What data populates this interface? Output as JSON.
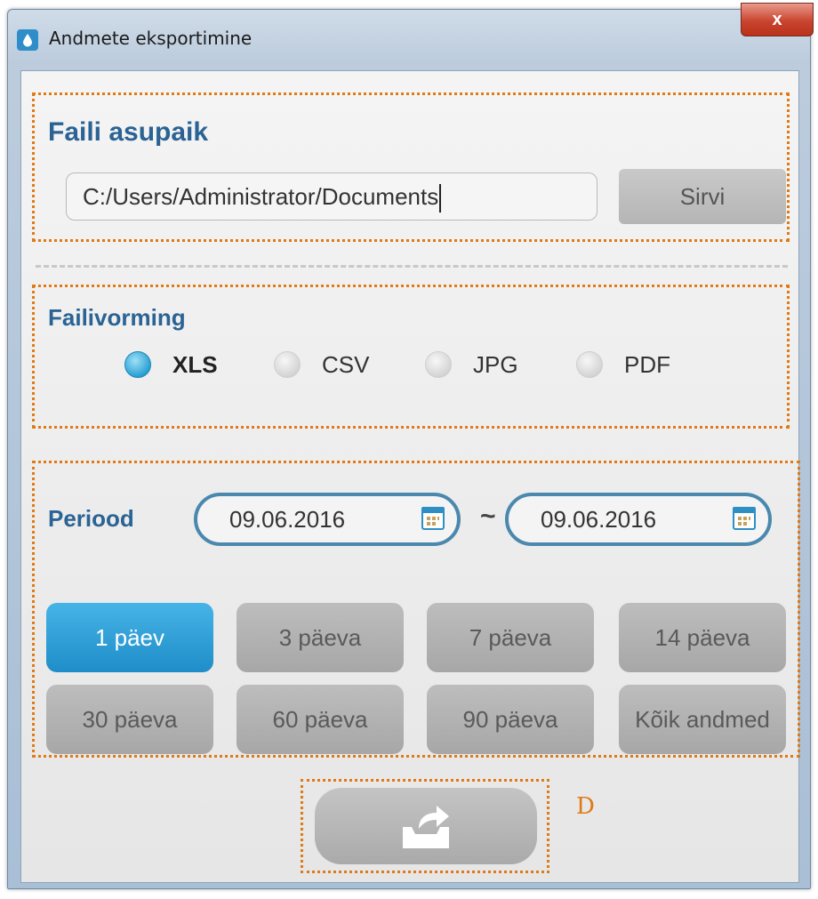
{
  "window": {
    "title": "Andmete eksportimine",
    "close_label": "x"
  },
  "location": {
    "heading": "Faili asupaik",
    "path_value": "C:/Users/Administrator/Documents",
    "browse_label": "Sirvi"
  },
  "format": {
    "heading": "Failivorming",
    "options": [
      "XLS",
      "CSV",
      "JPG",
      "PDF"
    ],
    "selected": "XLS"
  },
  "period": {
    "label": "Periood",
    "start_date": "09.06.2016",
    "separator": "~",
    "end_date": "09.06.2016",
    "ranges": [
      "1 päev",
      "3 päeva",
      "7 päeva",
      "14 päeva",
      "30 päeva",
      "60 päeva",
      "90 päeva",
      "Kõik andmed"
    ],
    "selected_range": "1 päev"
  },
  "annotation": {
    "export_marker": "D"
  },
  "colors": {
    "accent": "#1f8dc8",
    "annotation": "#e07a16",
    "heading": "#2a6394"
  }
}
